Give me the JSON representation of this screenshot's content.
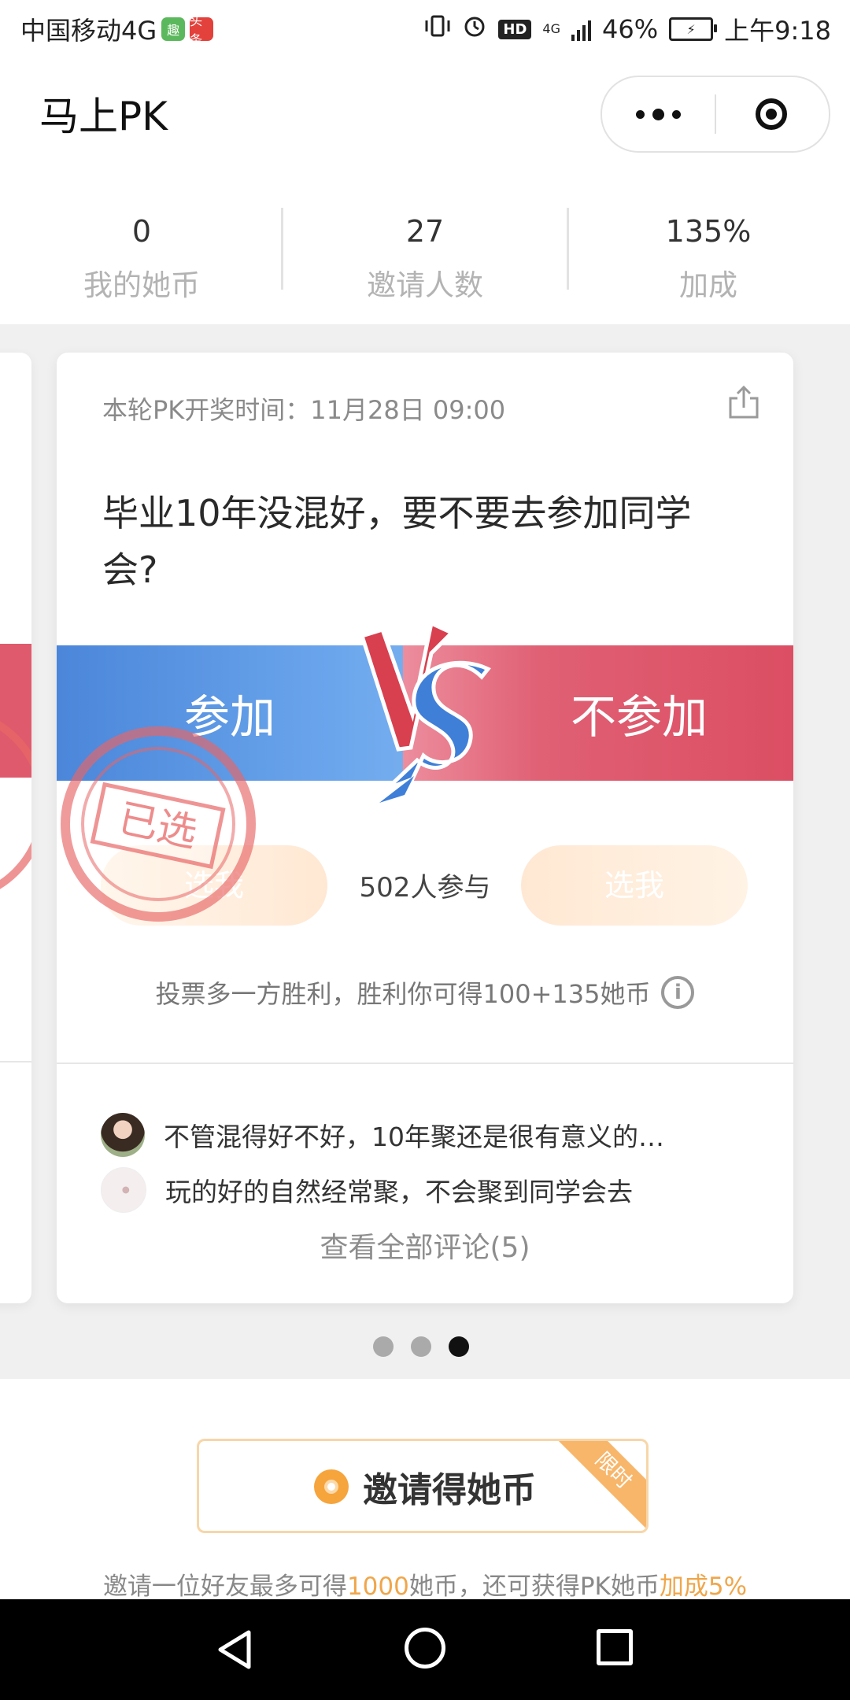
{
  "status_bar": {
    "carrier": "中国移动4G",
    "app1": "趣",
    "app2": "头条",
    "hd": "HD",
    "network": "4G",
    "battery_percent": "46%",
    "time": "上午9:18"
  },
  "nav": {
    "title": "马上PK"
  },
  "stats": [
    {
      "value": "0",
      "label": "我的她币"
    },
    {
      "value": "27",
      "label": "邀请人数"
    },
    {
      "value": "135%",
      "label": "加成"
    }
  ],
  "card": {
    "round_time": "本轮PK开奖时间：11月28日 09:00",
    "question": "毕业10年没混好，要不要去参加同学会?",
    "option_a": "参加",
    "option_b": "不参加",
    "pick_a_label": "选我",
    "pick_b_label": "选我",
    "participants": "502人参与",
    "stamp_label": "已选",
    "rule": "投票多一方胜利，胜利你可得100+135她币",
    "comments": [
      {
        "text": "不管混得好不好，10年聚还是很有意义的…"
      },
      {
        "text": "玩的好的自然经常聚，不会聚到同学会去"
      }
    ],
    "view_all": "查看全部评论(5)"
  },
  "pager": {
    "count": 3,
    "active_index": 2
  },
  "invite": {
    "button_label": "邀请得她币",
    "ribbon": "限时",
    "desc_1": "邀请一位好友最多可得",
    "desc_amount": "1000",
    "desc_2": "她币，还可获得PK她币",
    "desc_bonus": "加成5%"
  },
  "colors": {
    "blue": "#4b86da",
    "red": "#dc4e63",
    "orange": "#f0a64a",
    "stamp": "#e86666"
  }
}
